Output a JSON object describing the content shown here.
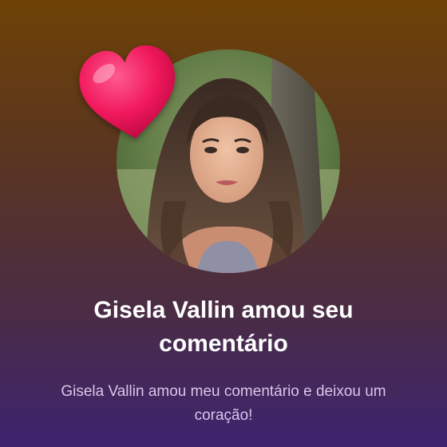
{
  "notification": {
    "title": "Gisela Vallin amou seu comentário",
    "message": "Gisela Vallin amou meu comentário e deixou um coração!"
  },
  "avatar": {
    "icon": "profile-photo"
  },
  "reaction": {
    "icon": "heart-icon",
    "color": "#f0185c"
  }
}
